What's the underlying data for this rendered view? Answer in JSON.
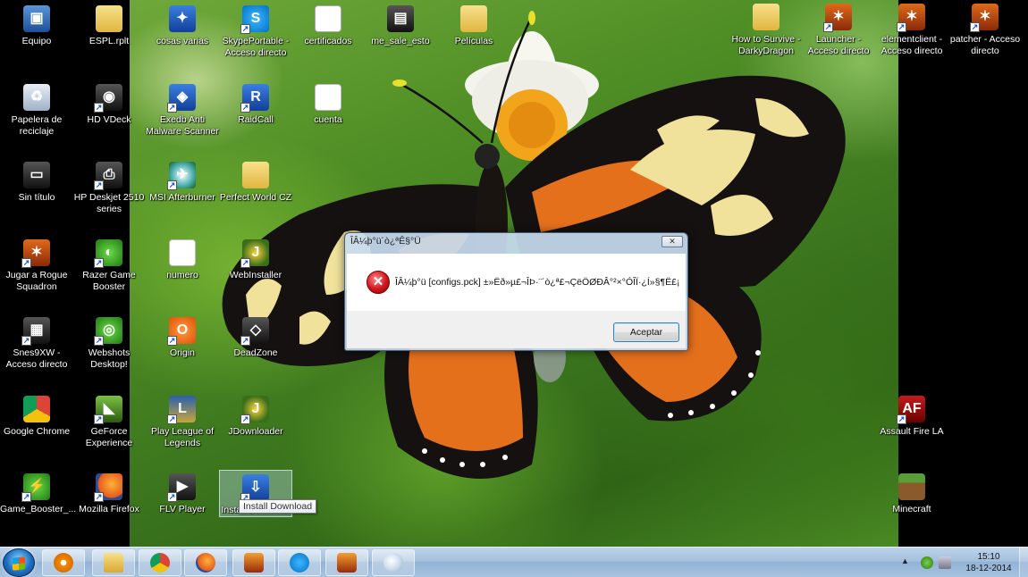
{
  "desktop": {
    "icons": [
      {
        "label": "Equipo",
        "icon": "computer-icon",
        "glyph": "▣"
      },
      {
        "label": "ESPL.rplt",
        "icon": "folder-icon",
        "glyph": ""
      },
      {
        "label": "cosas varias",
        "icon": "image-file-icon",
        "glyph": "✦"
      },
      {
        "label": "SkypePortable - Acceso directo",
        "icon": "skype-icon",
        "glyph": "S"
      },
      {
        "label": "certificados",
        "icon": "certificate-icon",
        "glyph": "✓"
      },
      {
        "label": "me_sale_esto",
        "icon": "image-icon",
        "glyph": "▤"
      },
      {
        "label": "Películas",
        "icon": "folder-icon",
        "glyph": ""
      },
      {
        "label": "Papelera de reciclaje",
        "icon": "recycle-bin-icon",
        "glyph": "♻"
      },
      {
        "label": "HD VDeck",
        "icon": "hd-vdeck-icon",
        "glyph": "◉"
      },
      {
        "label": "Exedb Anti Malware Scanner",
        "icon": "antimalware-icon",
        "glyph": "◈"
      },
      {
        "label": "RaidCall",
        "icon": "raidcall-icon",
        "glyph": "R"
      },
      {
        "label": "cuenta",
        "icon": "text-file-icon",
        "glyph": "≡"
      },
      {
        "label": "Sin título",
        "icon": "image-icon",
        "glyph": "▭"
      },
      {
        "label": "HP Deskjet 2510 series",
        "icon": "printer-icon",
        "glyph": "⎙"
      },
      {
        "label": "MSI Afterburner",
        "icon": "msi-afterburner-icon",
        "glyph": "✈"
      },
      {
        "label": "Perfect World CZ",
        "icon": "folder-icon",
        "glyph": ""
      },
      {
        "label": "Jugar a Rogue Squadron",
        "icon": "game-icon",
        "glyph": "✶"
      },
      {
        "label": "Razer Game Booster",
        "icon": "razer-icon",
        "glyph": "◐"
      },
      {
        "label": "numero",
        "icon": "text-file-icon",
        "glyph": "≡"
      },
      {
        "label": "WebInstaller",
        "icon": "jdownloader-icon",
        "glyph": "J"
      },
      {
        "label": "Snes9XW - Acceso directo",
        "icon": "snes-icon",
        "glyph": "▦"
      },
      {
        "label": "Webshots Desktop!",
        "icon": "webshots-icon",
        "glyph": "◎"
      },
      {
        "label": "Origin",
        "icon": "origin-icon",
        "glyph": "O"
      },
      {
        "label": "DeadZone",
        "icon": "unity-icon",
        "glyph": "◇"
      },
      {
        "label": "Google Chrome",
        "icon": "chrome-icon",
        "glyph": ""
      },
      {
        "label": "GeForce Experience",
        "icon": "geforce-icon",
        "glyph": "◣"
      },
      {
        "label": "Play League of Legends",
        "icon": "league-icon",
        "glyph": "L"
      },
      {
        "label": "JDownloader",
        "icon": "jdownloader-icon",
        "glyph": "J"
      },
      {
        "label": "Game_Booster_...",
        "icon": "game-booster-icon",
        "glyph": "⚡"
      },
      {
        "label": "Mozilla Firefox",
        "icon": "firefox-icon",
        "glyph": ""
      },
      {
        "label": "FLV Player",
        "icon": "flv-player-icon",
        "glyph": "▶"
      },
      {
        "label": "Install Download",
        "icon": "installer-icon",
        "glyph": "⇩"
      },
      {
        "label": "How to Survive - DarkyDragon",
        "icon": "folder-icon",
        "glyph": ""
      },
      {
        "label": "Launcher - Acceso directo",
        "icon": "game-icon",
        "glyph": "✶"
      },
      {
        "label": "elementclient - Acceso directo",
        "icon": "game-icon",
        "glyph": "✶"
      },
      {
        "label": "patcher - Acceso directo",
        "icon": "game-icon",
        "glyph": "✶"
      },
      {
        "label": "Assault Fire LA",
        "icon": "assault-fire-icon",
        "glyph": "AF"
      },
      {
        "label": "Minecraft",
        "icon": "minecraft-icon",
        "glyph": ""
      }
    ],
    "tooltip": "Install Download"
  },
  "dialog": {
    "title": "ÎÂ¼þ°ü´ò¿ªÊ§°Ü",
    "close_label": "✕",
    "icon": "error-icon",
    "message": "ÎÂ¼þ°ü [configs.pck] ±»Ëð»µ£¬ÎÞ·¨´ò¿ª£¬ÇëÖØÐÂ°²×°ÓÎÏ·¿Í»§¶Ë£¡",
    "accept_label": "Aceptar"
  },
  "taskbar": {
    "pinned": [
      {
        "name": "media-player",
        "icon": "media-player-icon"
      },
      {
        "name": "explorer",
        "icon": "explorer-icon"
      },
      {
        "name": "chrome",
        "icon": "chrome-icon"
      },
      {
        "name": "firefox",
        "icon": "firefox-icon"
      },
      {
        "name": "game-launcher",
        "icon": "game-icon"
      },
      {
        "name": "skype",
        "icon": "skype-icon"
      },
      {
        "name": "game-client",
        "icon": "game-icon"
      },
      {
        "name": "paint",
        "icon": "paint-icon"
      }
    ],
    "clock": {
      "time": "15:10",
      "date": "18-12-2014"
    }
  }
}
